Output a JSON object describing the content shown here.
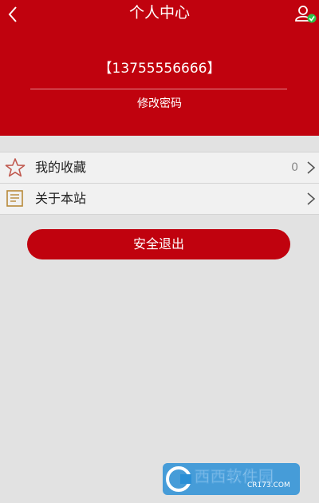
{
  "header": {
    "title": "个人中心",
    "phone": "【13755556666】",
    "change_password": "修改密码",
    "back_icon": "chevron-left-icon",
    "user_icon": "user-verified-icon"
  },
  "menu": {
    "items": [
      {
        "label": "我的收藏",
        "count": "0",
        "icon": "star-icon"
      },
      {
        "label": "关于本站",
        "icon": "note-icon"
      }
    ]
  },
  "logout": {
    "label": "安全退出"
  },
  "watermark": {
    "brand": "西西软件园",
    "url": "CR173.COM"
  },
  "colors": {
    "brand_red": "#c0020e",
    "background": "#e2e2e2",
    "row_background": "#f1f1f1"
  }
}
